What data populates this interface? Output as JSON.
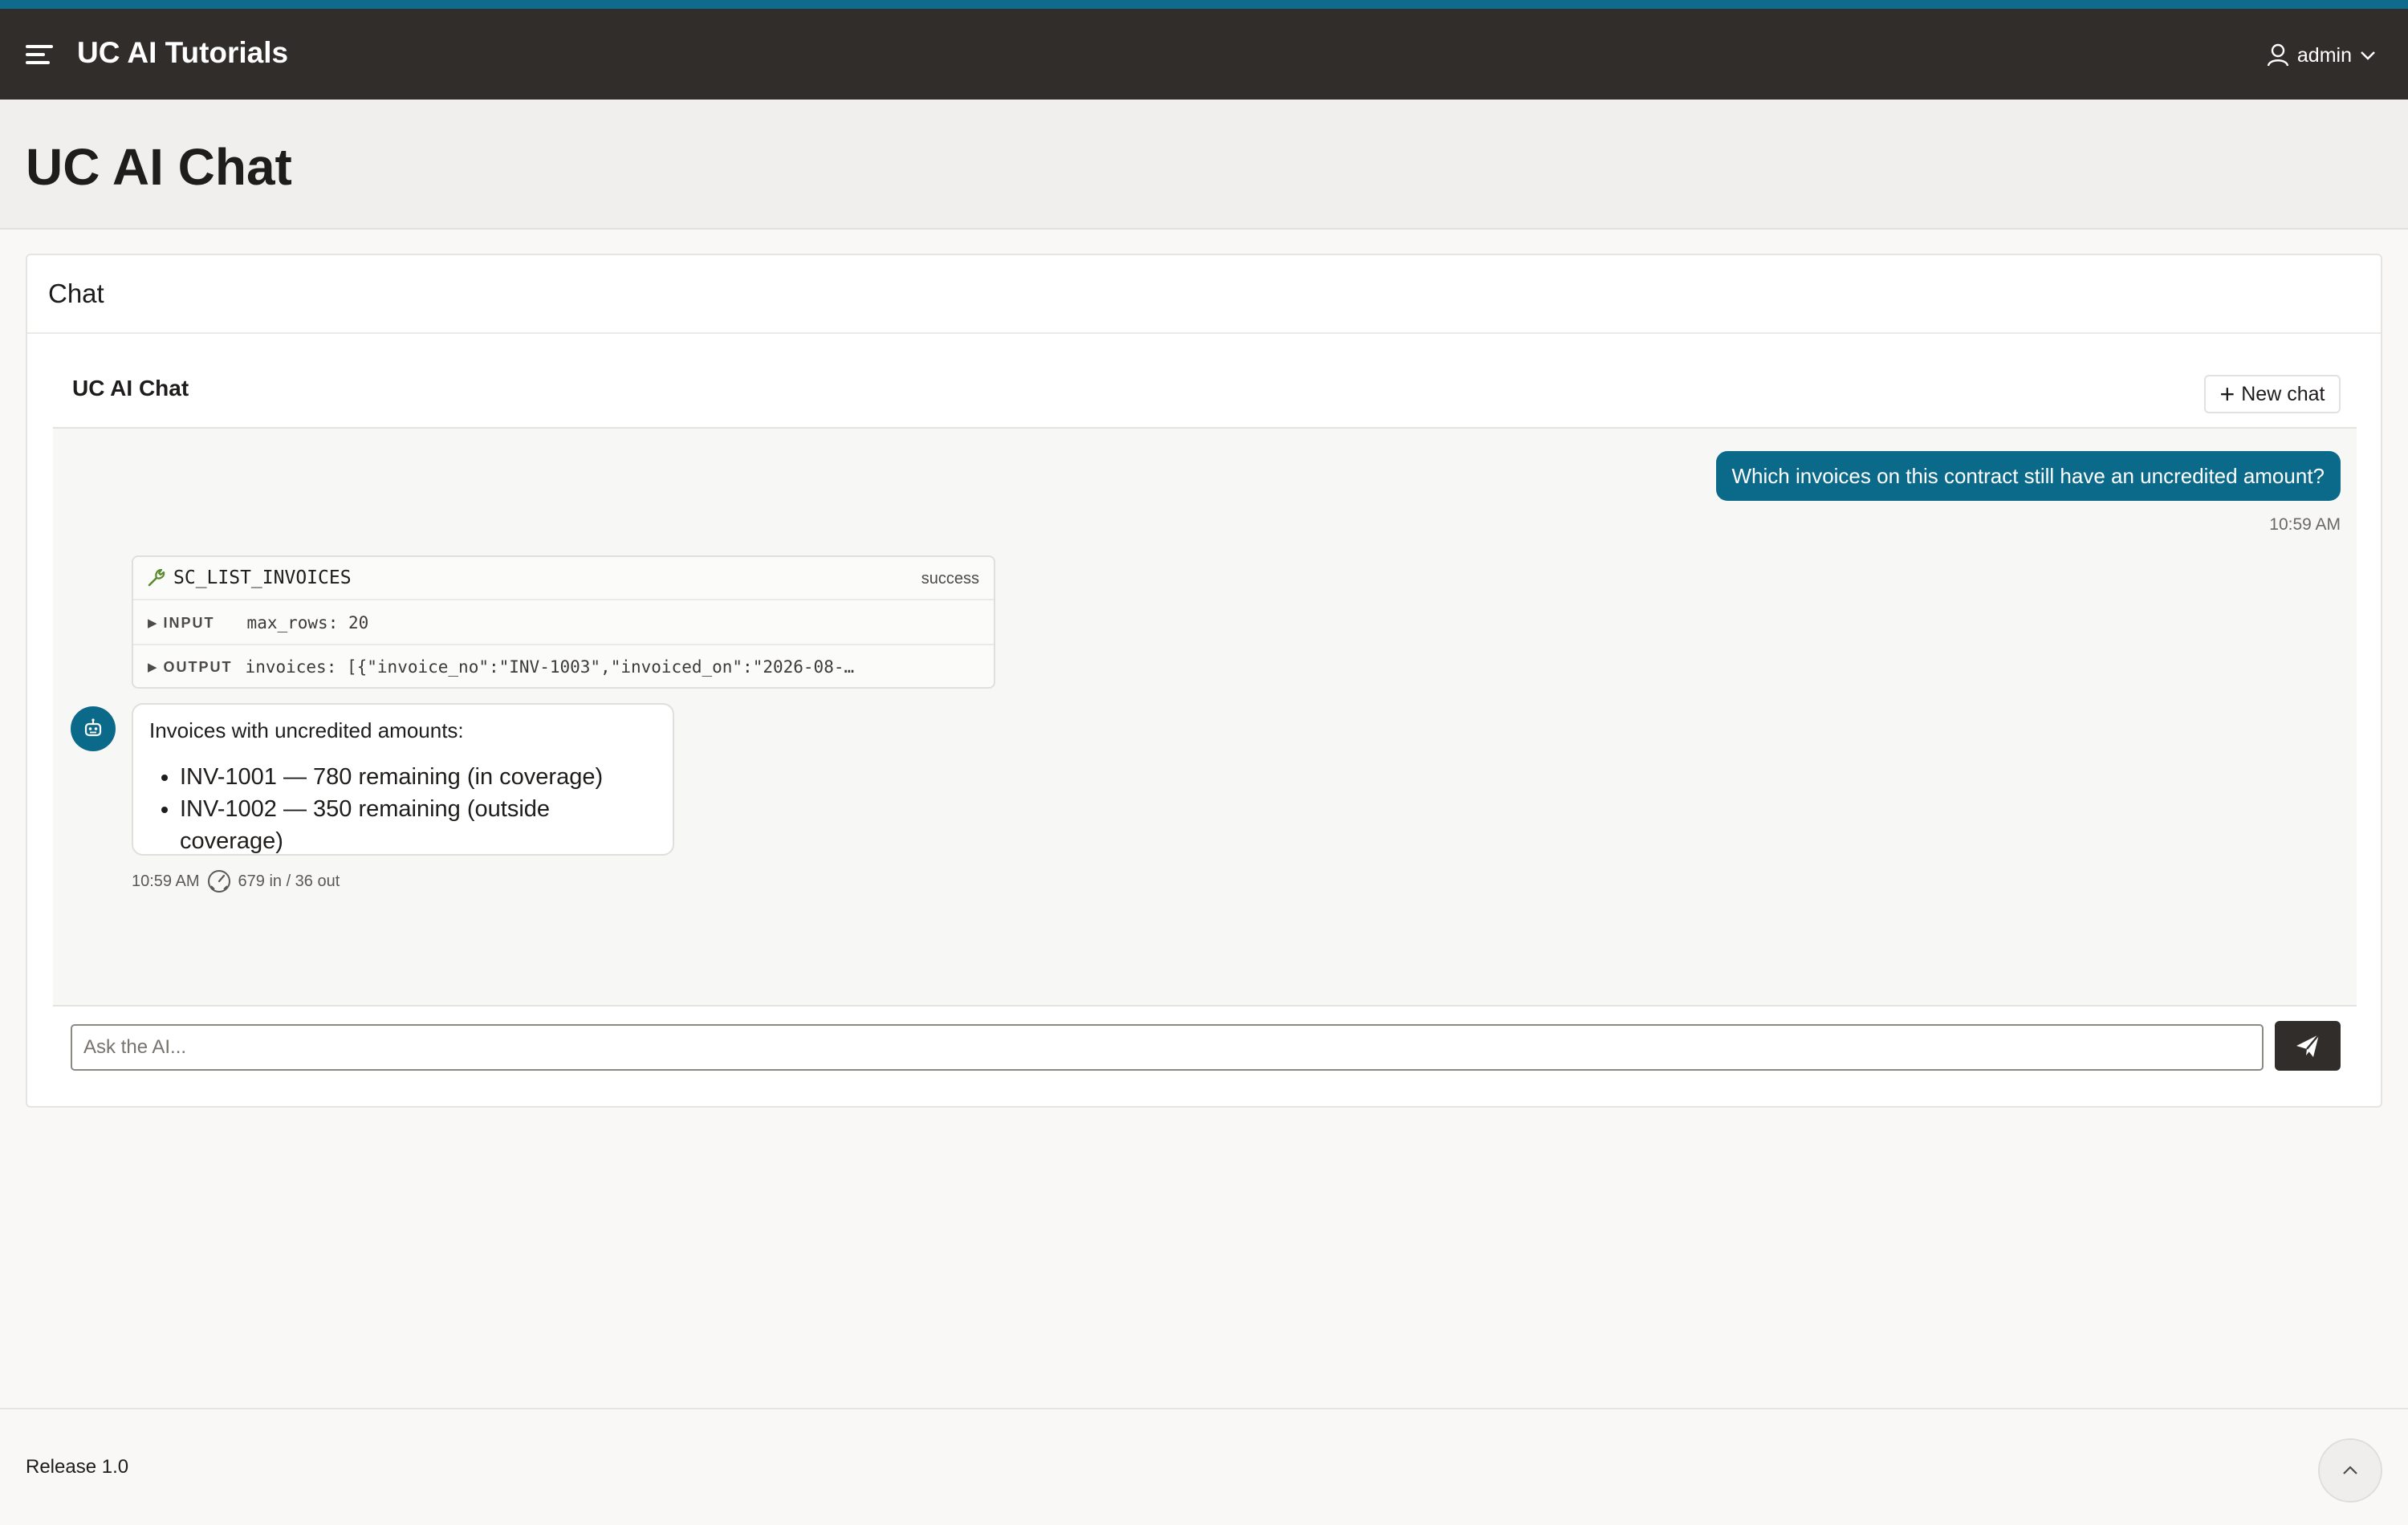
{
  "app": {
    "title": "UC AI Tutorials",
    "brand_color": "#0e6b8c",
    "header_bg": "#312d2a"
  },
  "user_menu": {
    "name": "admin"
  },
  "page": {
    "title": "UC AI Chat"
  },
  "card": {
    "title": "Chat"
  },
  "chat": {
    "title": "UC AI Chat",
    "new_chat_label": "New chat",
    "messages": [
      {
        "role": "user",
        "text": "Which invoices on this contract still have an uncredited amount?",
        "time": "10:59 AM"
      },
      {
        "role": "tool",
        "name": "SC_LIST_INVOICES",
        "status": "success",
        "input_label": "INPUT",
        "input_value": "max_rows: 20",
        "output_label": "OUTPUT",
        "output_value": "invoices: [{\"invoice_no\":\"INV-1003\",\"invoiced_on\":\"2026-08-…"
      },
      {
        "role": "assistant",
        "intro": "Invoices with uncredited amounts:",
        "items": [
          "INV-1001 — 780 remaining (in coverage)",
          "INV-1002 — 350 remaining (outside coverage)"
        ],
        "time": "10:59 AM",
        "tokens": "679 in / 36 out"
      }
    ],
    "input_placeholder": "Ask the AI..."
  },
  "footer": {
    "release": "Release 1.0"
  },
  "icons": {
    "menu": "hamburger-icon",
    "user": "user-icon",
    "chevron": "chevron-down-icon",
    "plus": "plus-icon",
    "wrench": "wrench-icon",
    "bot": "robot-icon",
    "gauge": "gauge-icon",
    "send": "paper-plane-icon",
    "up": "chevron-up-icon"
  }
}
